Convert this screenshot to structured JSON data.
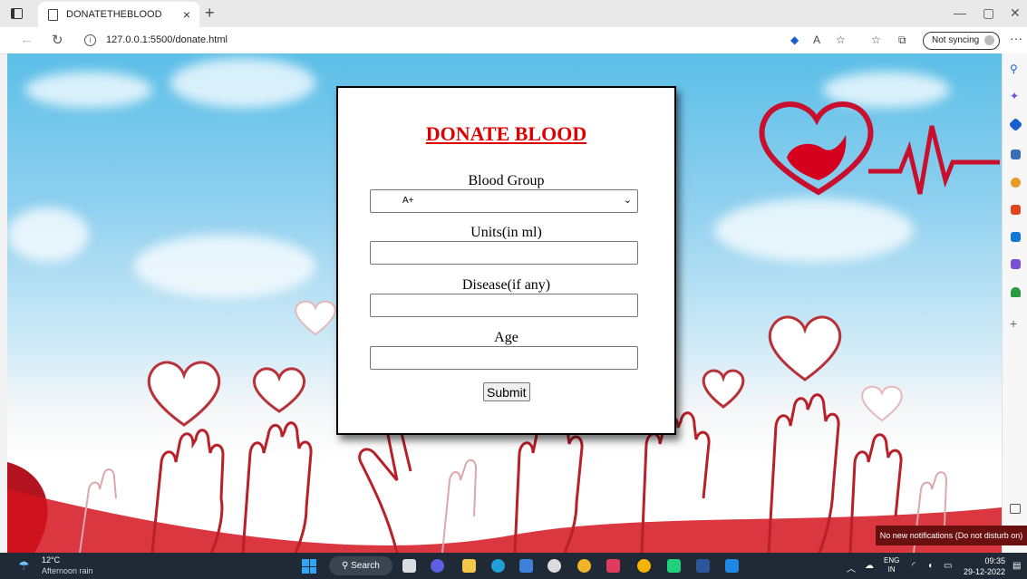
{
  "browser": {
    "tab_title": "DONATETHEBLOOD",
    "tab_close": "×",
    "new_tab": "+",
    "url": "127.0.0.1:5500/donate.html",
    "sync_label": "Not syncing",
    "minimize": "—",
    "restore": "▢",
    "close": "✕",
    "more": "···"
  },
  "form": {
    "heading": "DONATE BLOOD",
    "blood_group_label": "Blood Group",
    "blood_group_value": "A+",
    "units_label": "Units(in ml)",
    "units_value": "",
    "disease_label": "Disease(if any)",
    "disease_value": "",
    "age_label": "Age",
    "age_value": "",
    "submit_label": "Submit"
  },
  "notification": {
    "text": "No new notifications (Do not disturb on)"
  },
  "taskbar": {
    "temperature": "12°C",
    "weather": "Afternoon rain",
    "search_label": "Search",
    "language": "ENG",
    "region": "IN",
    "time": "09:35",
    "date": "29-12-2022"
  },
  "colors": {
    "heading_red": "#e00000",
    "taskbar_bg": "#1f2a36",
    "sky_blue": "#5cbfe8"
  }
}
